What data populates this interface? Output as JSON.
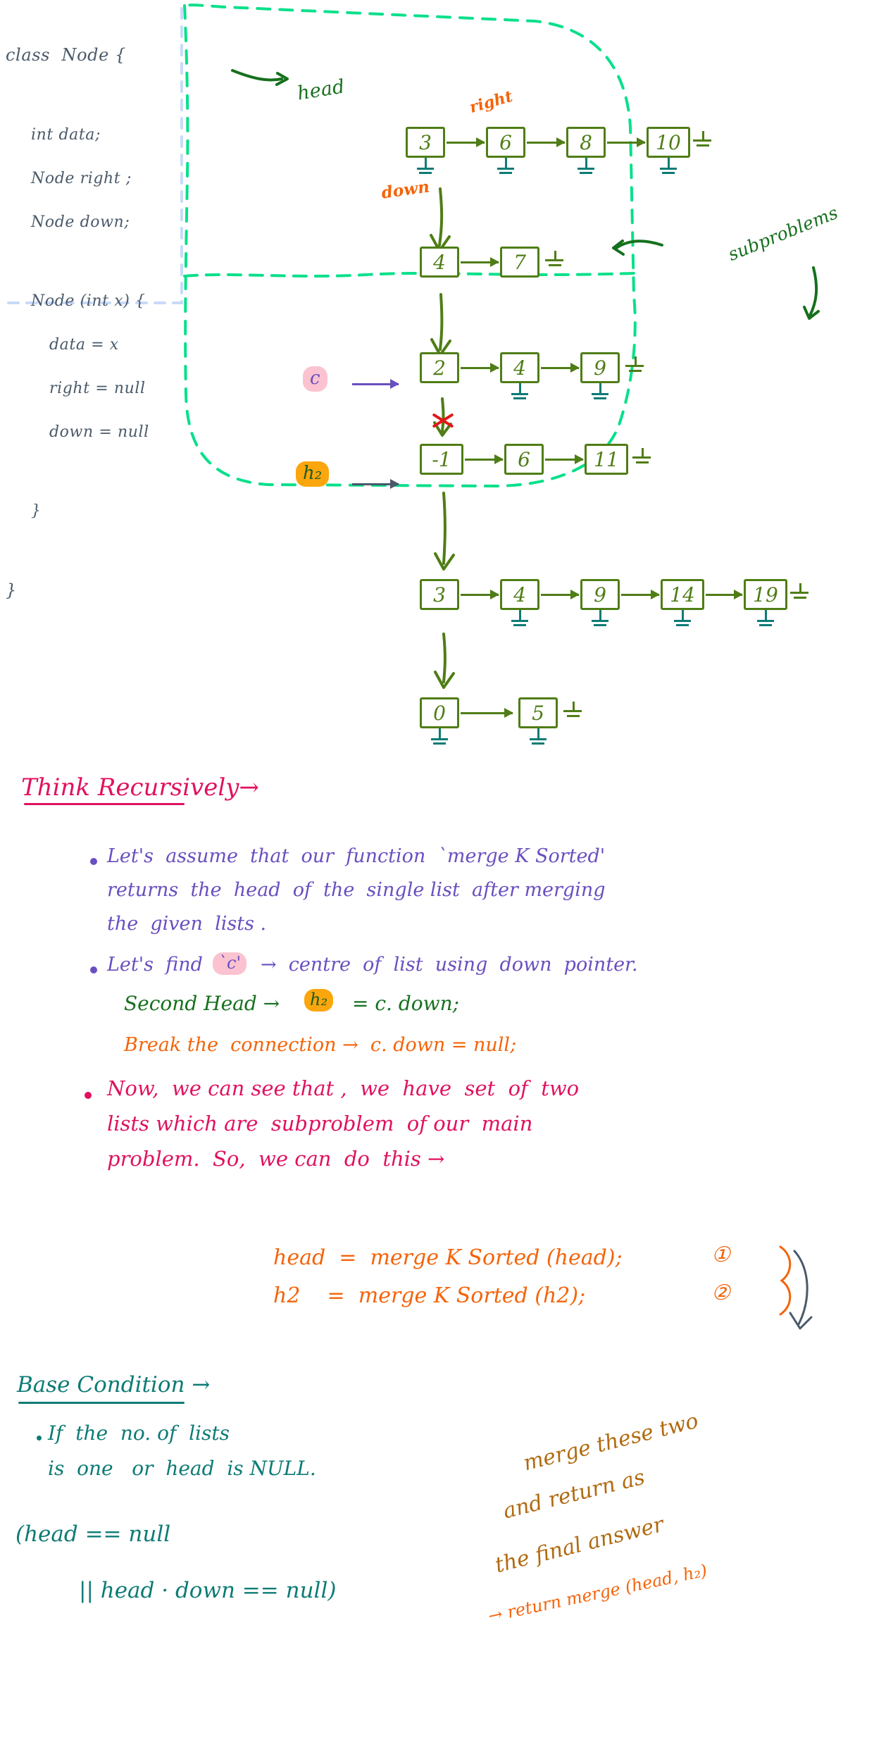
{
  "page": {
    "title": "Merge K Sorted Linked Lists - handwritten notes",
    "background": "#ffffff"
  },
  "colors": {
    "ink_dark": "#4a5a6a",
    "node_green": "#4f7d16",
    "head_green": "#16701d",
    "orange": "#f4640a",
    "pink": "#e0115f",
    "purple": "#6a4fc0",
    "teal": "#0d7b75",
    "mint_dashed": "#07e08a",
    "light_blue_dashed": "#c8daf7",
    "red": "#e01818",
    "brown": "#b06a10",
    "highlight_pink": "#fbc2d0",
    "highlight_orange": "#fba60d"
  },
  "code_block": {
    "lines": [
      "class  Node {",
      "int data;",
      "Node right ;",
      "Node down;",
      "Node (int x) {",
      "data = x",
      "right = null",
      "down = null",
      "}",
      "}"
    ],
    "line_1": "class  Node {",
    "line_2": "int data;",
    "line_3": "Node right ;",
    "line_4": "Node down;",
    "line_5": "Node (int x) {",
    "line_6": "data = x",
    "line_7": "right = null",
    "line_8": "down = null",
    "line_9": "}",
    "line_10": "}"
  },
  "diagram": {
    "labels": {
      "head": "head",
      "right": "right",
      "down": "down",
      "subproblems": "subproblems",
      "c": "c",
      "h2": "h₂"
    },
    "rows": [
      {
        "id": "row1",
        "values": [
          "3",
          "6",
          "8",
          "10"
        ]
      },
      {
        "id": "row2",
        "values": [
          "4",
          "7"
        ]
      },
      {
        "id": "row3",
        "values": [
          "2",
          "4",
          "9"
        ]
      },
      {
        "id": "row4",
        "values": [
          "-1",
          "6",
          "11"
        ]
      },
      {
        "id": "row5",
        "values": [
          "3",
          "4",
          "9",
          "14",
          "19"
        ]
      },
      {
        "id": "row6",
        "values": [
          "0",
          "5"
        ]
      }
    ],
    "row1": {
      "n1": "3",
      "n2": "6",
      "n3": "8",
      "n4": "10"
    },
    "row2": {
      "n1": "4",
      "n2": "7"
    },
    "row3": {
      "n1": "2",
      "n2": "4",
      "n3": "9"
    },
    "row4": {
      "n1": "-1",
      "n2": "6",
      "n3": "11"
    },
    "row5": {
      "n1": "3",
      "n2": "4",
      "n3": "9",
      "n4": "14",
      "n5": "19"
    },
    "row6": {
      "n1": "0",
      "n2": "5"
    }
  },
  "notes": {
    "think_heading": "Think Recursively→",
    "bullet1_l1": "Let's  assume  that  our  function  `merge K Sorted'",
    "bullet1_l2": "returns  the  head  of  the  single list  after merging",
    "bullet1_l3": "the  given  lists .",
    "bullet2_pre": "Let's  find",
    "bullet2_c": "`c'",
    "bullet2_post": "→  centre  of  list  using  down  pointer.",
    "second_head_label": "Second Head →",
    "second_head_chip": "h₂",
    "second_head_eq": "= c. down;",
    "break_connection": "Break the  connection →  c. down = null;",
    "bullet3_l1": "Now,  we can see that ,  we  have  set  of  two",
    "bullet3_l2": "lists which are  subproblem  of our  main",
    "bullet3_l3": "problem.  So,  we can  do  this →",
    "code_line_1": "head  =  merge K Sorted (head);",
    "code_line_1_num": "①",
    "code_line_2": "h2    =  merge K Sorted (h2);",
    "code_line_2_num": "②",
    "base_heading": "Base Condition →",
    "base_l1": "If  the  no. of  lists",
    "base_l2": "is  one   or  head  is NULL.",
    "base_code_l1": "(head == null",
    "base_code_l2": "|| head · down == null)",
    "merge_note_l1": "merge these two",
    "merge_note_l2": "and return as",
    "merge_note_l3": "the final answer",
    "merge_note_l4": "→ return merge (head, h₂)"
  }
}
